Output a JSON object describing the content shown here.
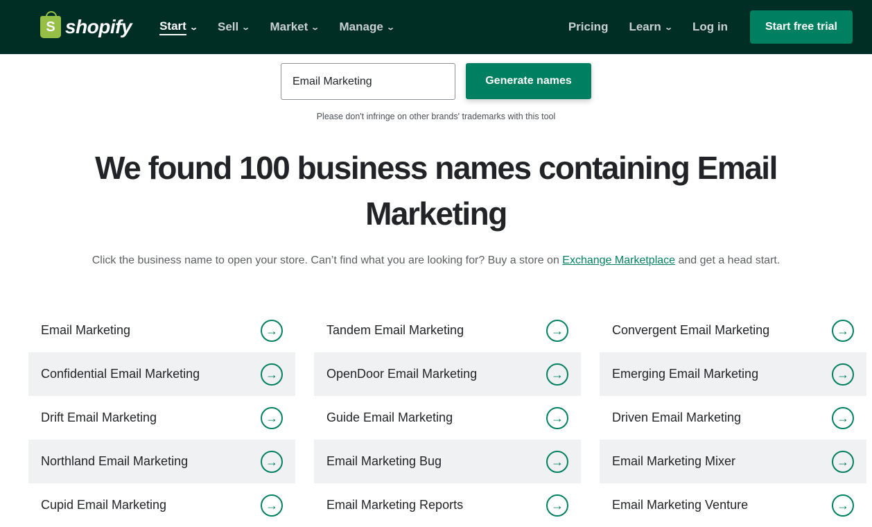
{
  "header": {
    "logo": "shopify",
    "nav": [
      {
        "label": "Start",
        "active": true
      },
      {
        "label": "Sell"
      },
      {
        "label": "Market"
      },
      {
        "label": "Manage"
      }
    ],
    "pricing": "Pricing",
    "learn": "Learn",
    "login": "Log in",
    "trial": "Start free trial"
  },
  "search": {
    "value": "Email Marketing",
    "button": "Generate names",
    "note": "Please don't infringe on other brands' trademarks with this tool"
  },
  "heading": "We found 100 business names containing Email Marketing",
  "subtitle": {
    "before": "Click the business name to open your store. Can’t find what you are looking for? Buy a store on ",
    "link": "Exchange Marketplace",
    "after": " and get a head start."
  },
  "names": [
    "Email Marketing",
    "Tandem Email Marketing",
    "Convergent Email Marketing",
    "Confidential Email Marketing",
    "OpenDoor Email Marketing",
    "Emerging Email Marketing",
    "Drift Email Marketing",
    "Guide Email Marketing",
    "Driven Email Marketing",
    "Northland Email Marketing",
    "Email Marketing Bug",
    "Email Marketing Mixer",
    "Cupid Email Marketing",
    "Email Marketing Reports",
    "Email Marketing Venture"
  ],
  "colors": {
    "header": "#002e25",
    "accent": "#008060"
  }
}
